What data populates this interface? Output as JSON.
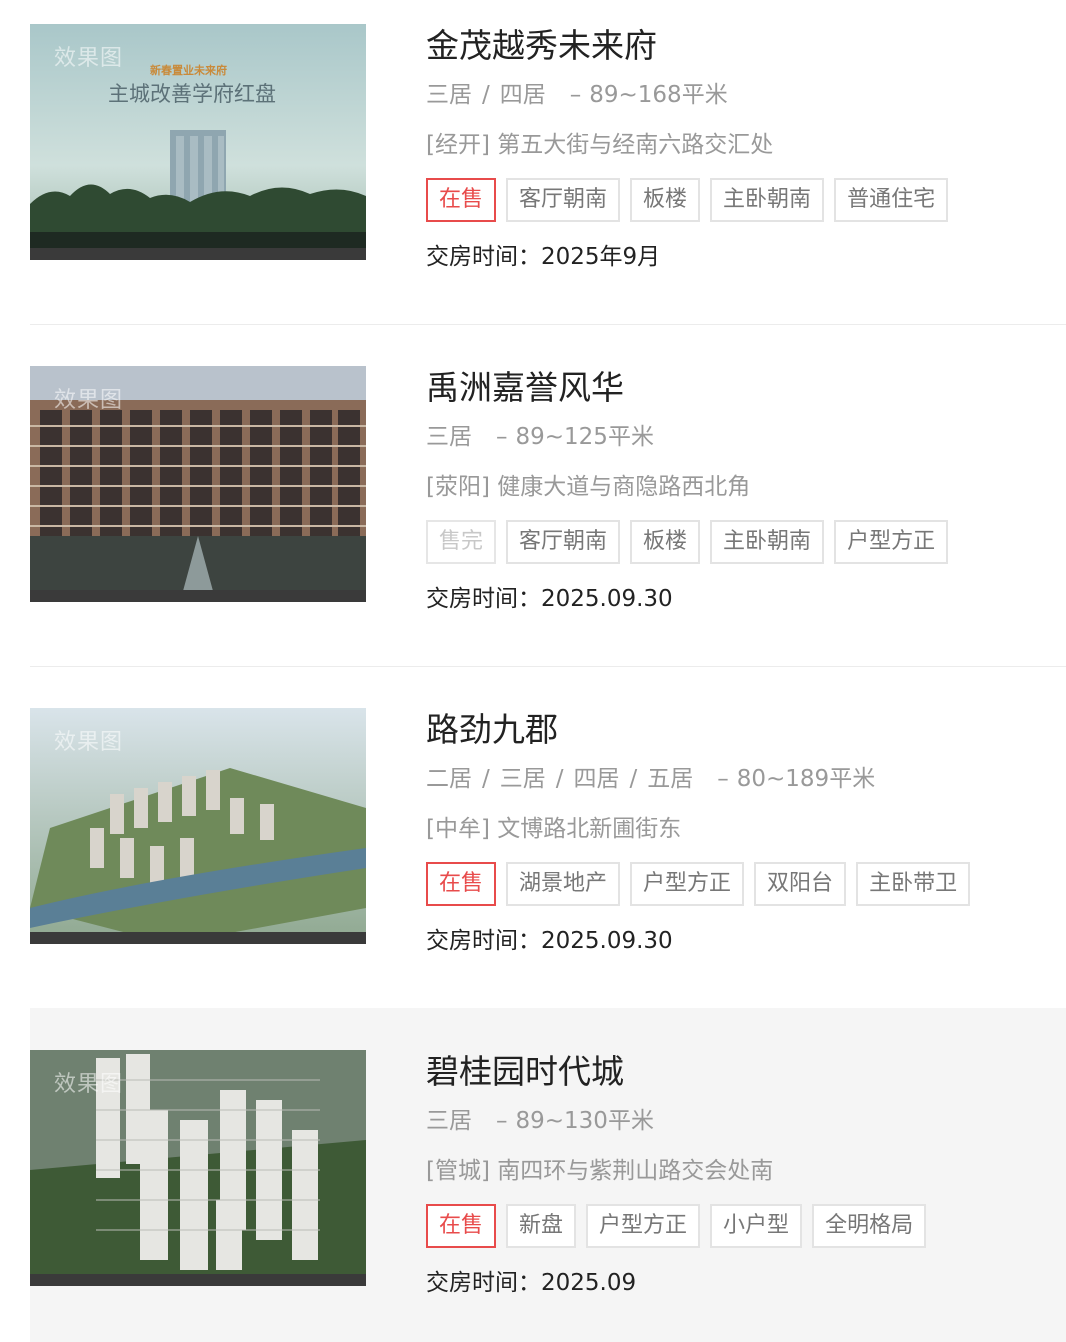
{
  "listings": [
    {
      "name": "金茂越秀未来府",
      "layouts": [
        "三居",
        "四居"
      ],
      "area": "89~168平米",
      "district": "[经开]",
      "address": "第五大街与经南六路交汇处",
      "status": "在售",
      "tags": [
        "客厅朝南",
        "板楼",
        "主卧朝南",
        "普通住宅"
      ],
      "handover_label": "交房时间：",
      "handover": "2025年9月",
      "image_label": "效果图",
      "image_caption_small": "新春置业未来府",
      "image_caption": "主城改善学府红盘"
    },
    {
      "name": "禹洲嘉誉风华",
      "layouts": [
        "三居"
      ],
      "area": "89~125平米",
      "district": "[荥阳]",
      "address": "健康大道与商隐路西北角",
      "status": "售完",
      "tags": [
        "客厅朝南",
        "板楼",
        "主卧朝南",
        "户型方正"
      ],
      "handover_label": "交房时间：",
      "handover": "2025.09.30",
      "image_label": "效果图"
    },
    {
      "name": "路劲九郡",
      "layouts": [
        "二居",
        "三居",
        "四居",
        "五居"
      ],
      "area": "80~189平米",
      "district": "[中牟]",
      "address": "文博路北新圃街东",
      "status": "在售",
      "tags": [
        "湖景地产",
        "户型方正",
        "双阳台",
        "主卧带卫"
      ],
      "handover_label": "交房时间：",
      "handover": "2025.09.30",
      "image_label": "效果图"
    },
    {
      "name": "碧桂园时代城",
      "layouts": [
        "三居"
      ],
      "area": "89~130平米",
      "district": "[管城]",
      "address": "南四环与紫荆山路交会处南",
      "status": "在售",
      "tags": [
        "新盘",
        "户型方正",
        "小户型",
        "全明格局"
      ],
      "handover_label": "交房时间：",
      "handover": "2025.09",
      "image_label": "效果图"
    }
  ],
  "colors": {
    "status_onsale": "#e84b4b",
    "status_soldout": "#c8c8c8",
    "muted_text": "#999999",
    "highlight_bg": "#f5f5f5"
  }
}
